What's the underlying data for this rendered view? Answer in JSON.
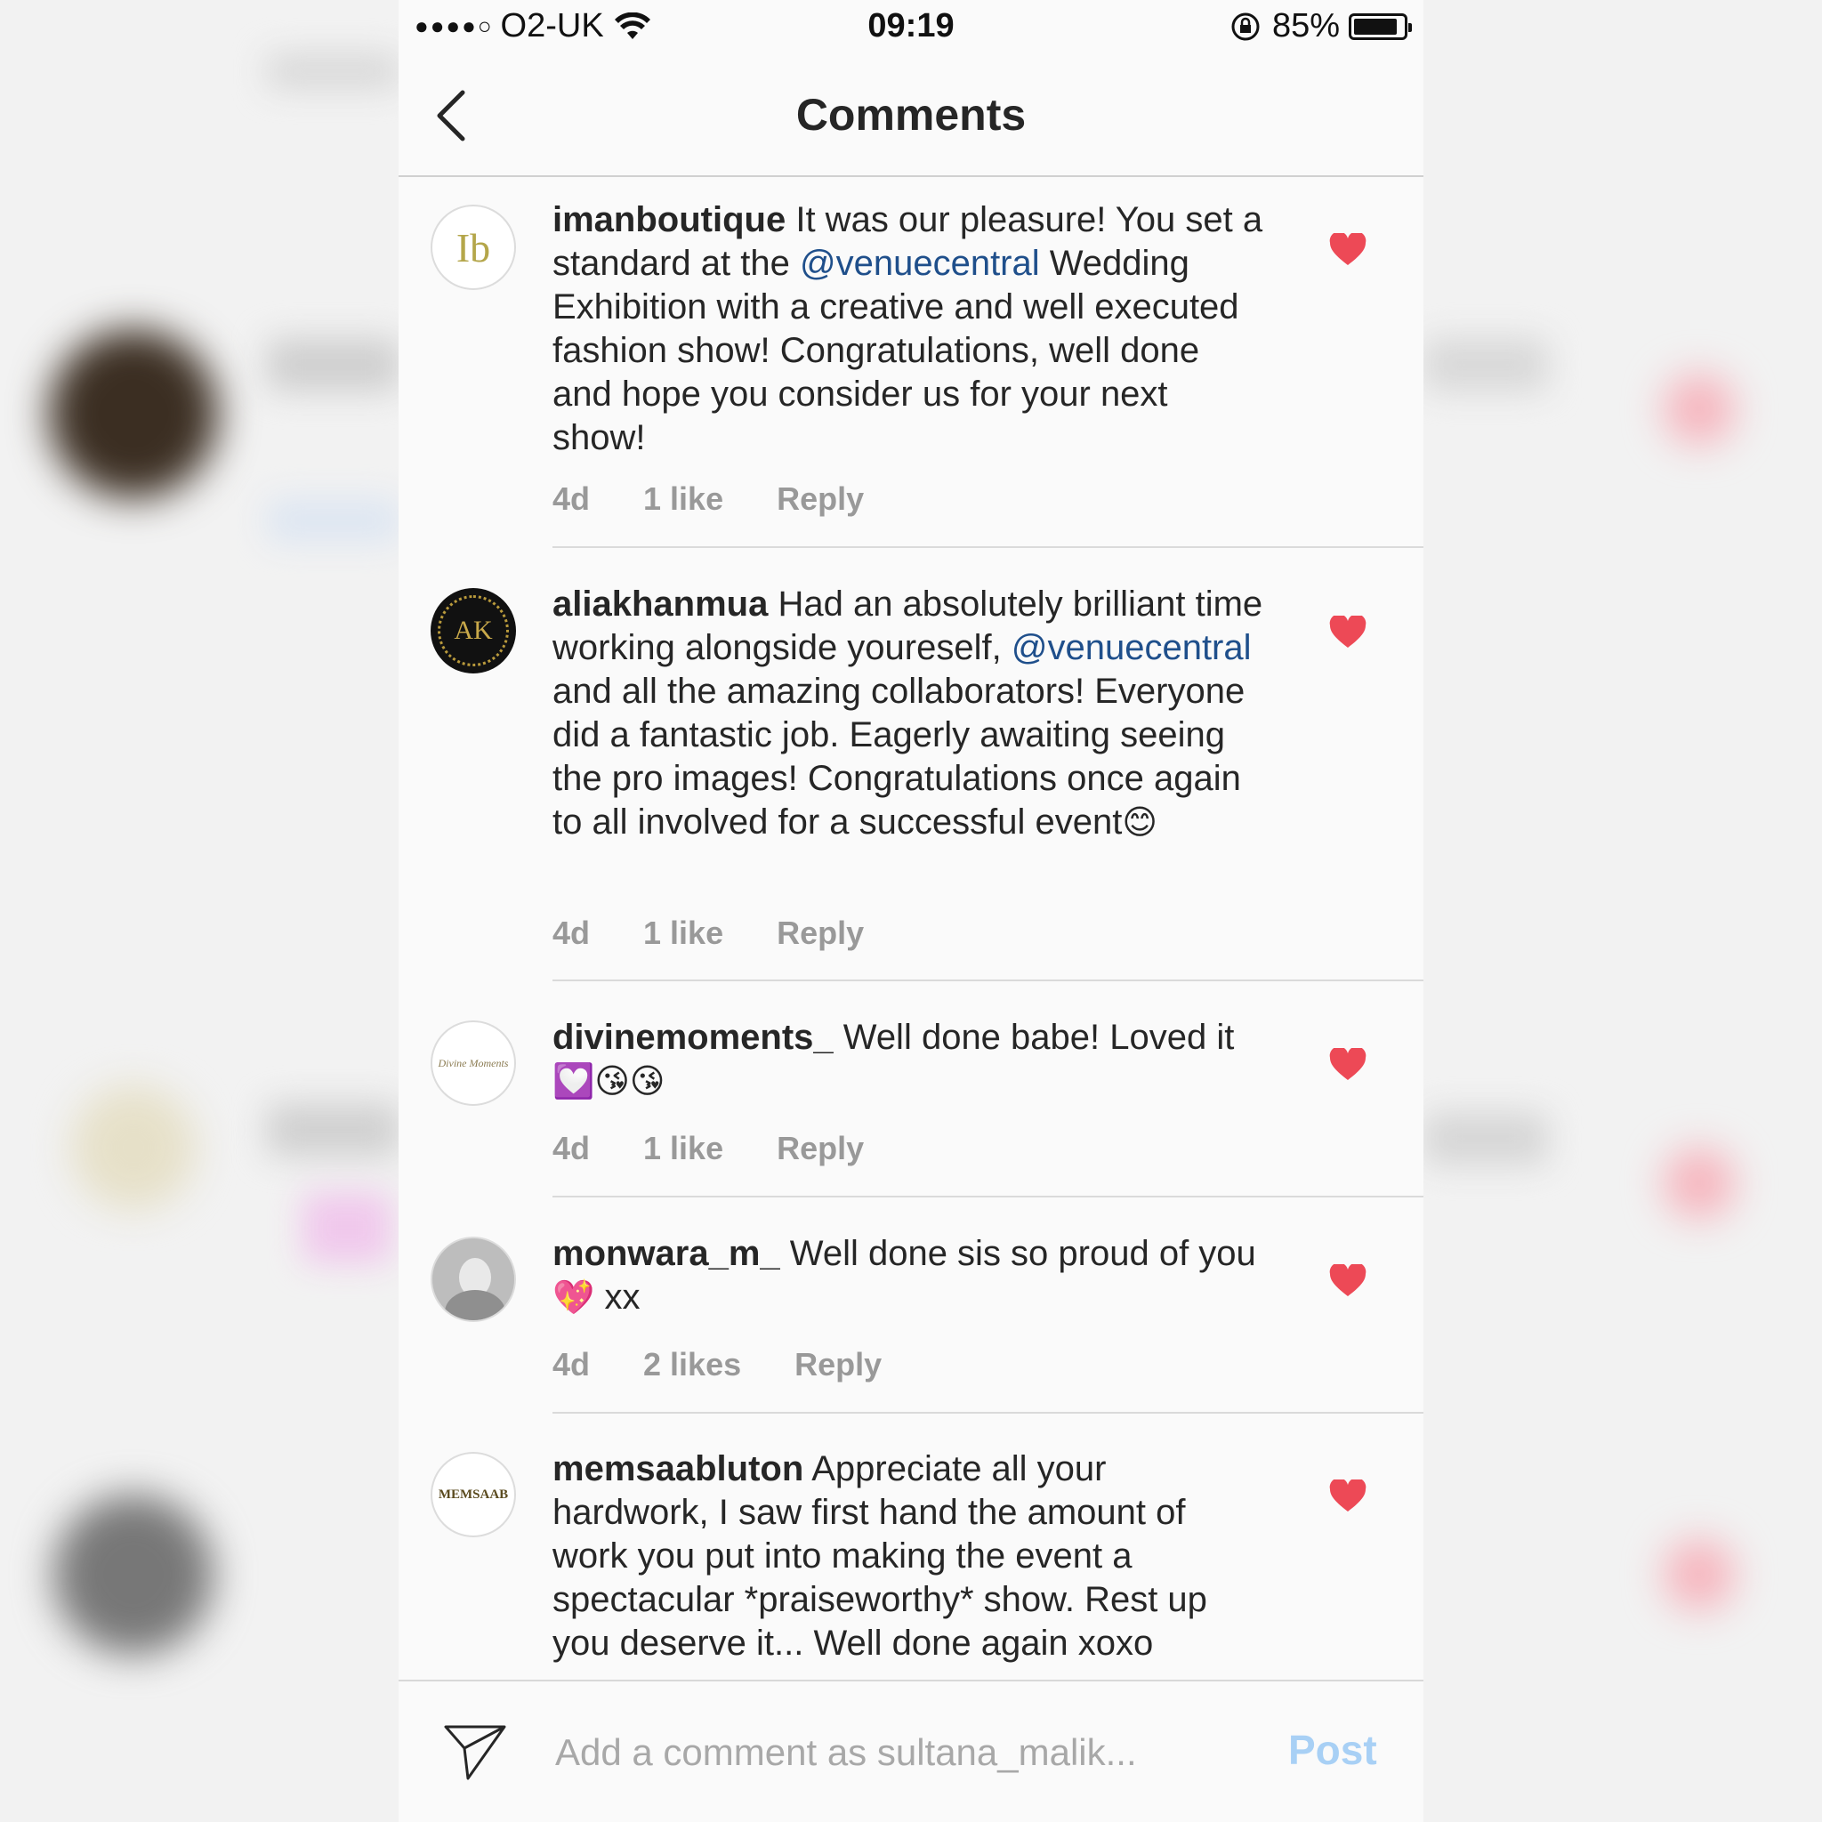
{
  "status_bar": {
    "signal": "●●●●○",
    "carrier": "O2-UK",
    "time": "09:19",
    "battery": "85%"
  },
  "nav": {
    "title": "Comments"
  },
  "comments": [
    {
      "username": "imanboutique",
      "text_before": "It was our pleasure! You set a standard at the",
      "mention": "@venuecentral",
      "text_after": "Wedding Exhibition with a creative and well executed fashion show! Congratulations, well done and hope you consider us for your next show!",
      "time": "4d",
      "likes": "1 like",
      "reply": "Reply",
      "avatar_text": "Ib"
    },
    {
      "username": "aliakhanmua",
      "text_before": "Had an absolutely brilliant time working alongside youreself,",
      "mention": "@venuecentral",
      "text_after": "and all the amazing collaborators! Everyone did a fantastic job. Eagerly awaiting seeing the pro images! Congratulations once again to all involved for a successful event",
      "emoji": "😊",
      "time": "4d",
      "likes": "1 like",
      "reply": "Reply",
      "avatar_text": "AK"
    },
    {
      "username": "divinemoments_",
      "text": "Well done babe! Loved it",
      "emoji": "💟😘😘",
      "time": "4d",
      "likes": "1 like",
      "reply": "Reply",
      "avatar_text": "Divine Moments"
    },
    {
      "username": "monwara_m_",
      "text": "Well done sis so proud of you",
      "emoji": "💖",
      "text_end": "xx",
      "time": "4d",
      "likes": "2 likes",
      "reply": "Reply"
    },
    {
      "username": "memsaabluton",
      "text": "Appreciate all your hardwork, I saw first hand the amount of work you put into making the event a spectacular *praiseworthy* show. Rest up you deserve it... Well done again xoxo",
      "avatar_text": "MEMSAAB"
    }
  ],
  "composer": {
    "placeholder": "Add a comment as sultana_malik...",
    "post_label": "Post"
  },
  "colors": {
    "heart": "#ed4956",
    "mention": "#1f4f8b",
    "post": "#a8d0f5",
    "meta": "#999999"
  }
}
